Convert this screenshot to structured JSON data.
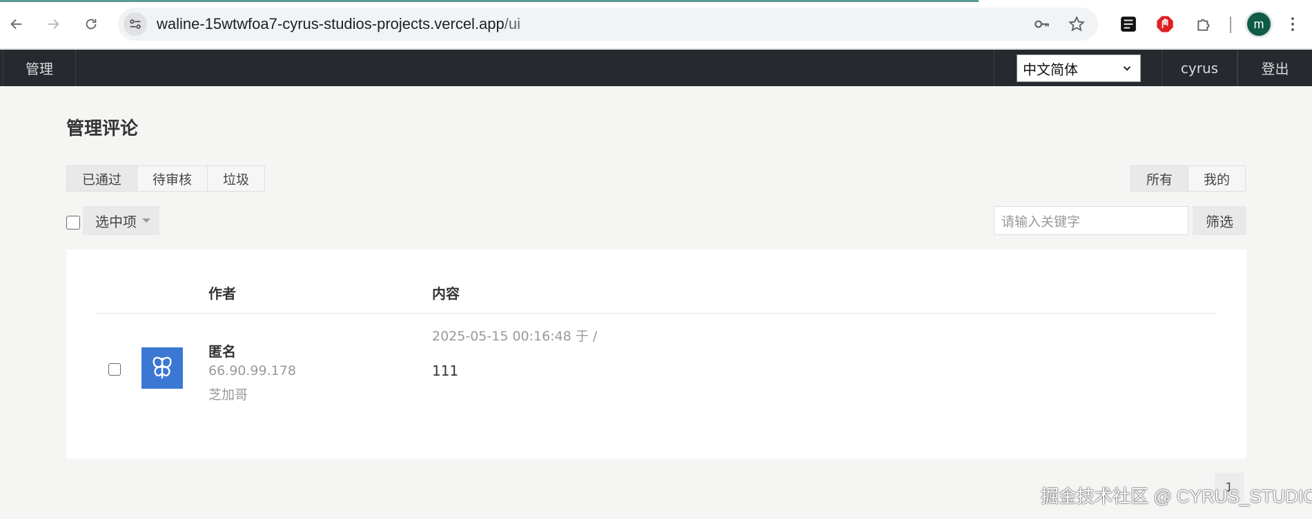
{
  "browser": {
    "url_host": "waline-15wtwfoa7-cyrus-studios-projects.vercel.app",
    "url_path": "/ui",
    "profile_initial": "m",
    "icons": [
      "back-arrow-icon",
      "forward-arrow-icon",
      "reload-icon",
      "site-info-icon",
      "key-icon",
      "star-icon",
      "extension-icon",
      "puzzle-icon",
      "kebab-menu-icon"
    ]
  },
  "appbar": {
    "brand": "管理",
    "language": "中文简体",
    "user": "cyrus",
    "logout": "登出"
  },
  "page": {
    "title": "管理评论",
    "status_tabs": [
      "已通过",
      "待审核",
      "垃圾"
    ],
    "owner_tabs": [
      "所有",
      "我的"
    ],
    "bulk_label": "选中项",
    "search_placeholder": "请输入关键字",
    "filter_label": "筛选"
  },
  "table": {
    "headers": {
      "author": "作者",
      "content": "内容"
    },
    "rows": [
      {
        "author": "匿名",
        "ip": "66.90.99.178",
        "location": "芝加哥",
        "meta": "2025-05-15 00:16:48 于 /",
        "content": "111"
      }
    ]
  },
  "pagination": {
    "current": "1"
  },
  "watermark": "掘金技术社区 @ CYRUS_STUDIO",
  "colors": {
    "appbar": "#262a2f",
    "avatar": "#3a78d4",
    "profile": "#0f5b46"
  }
}
